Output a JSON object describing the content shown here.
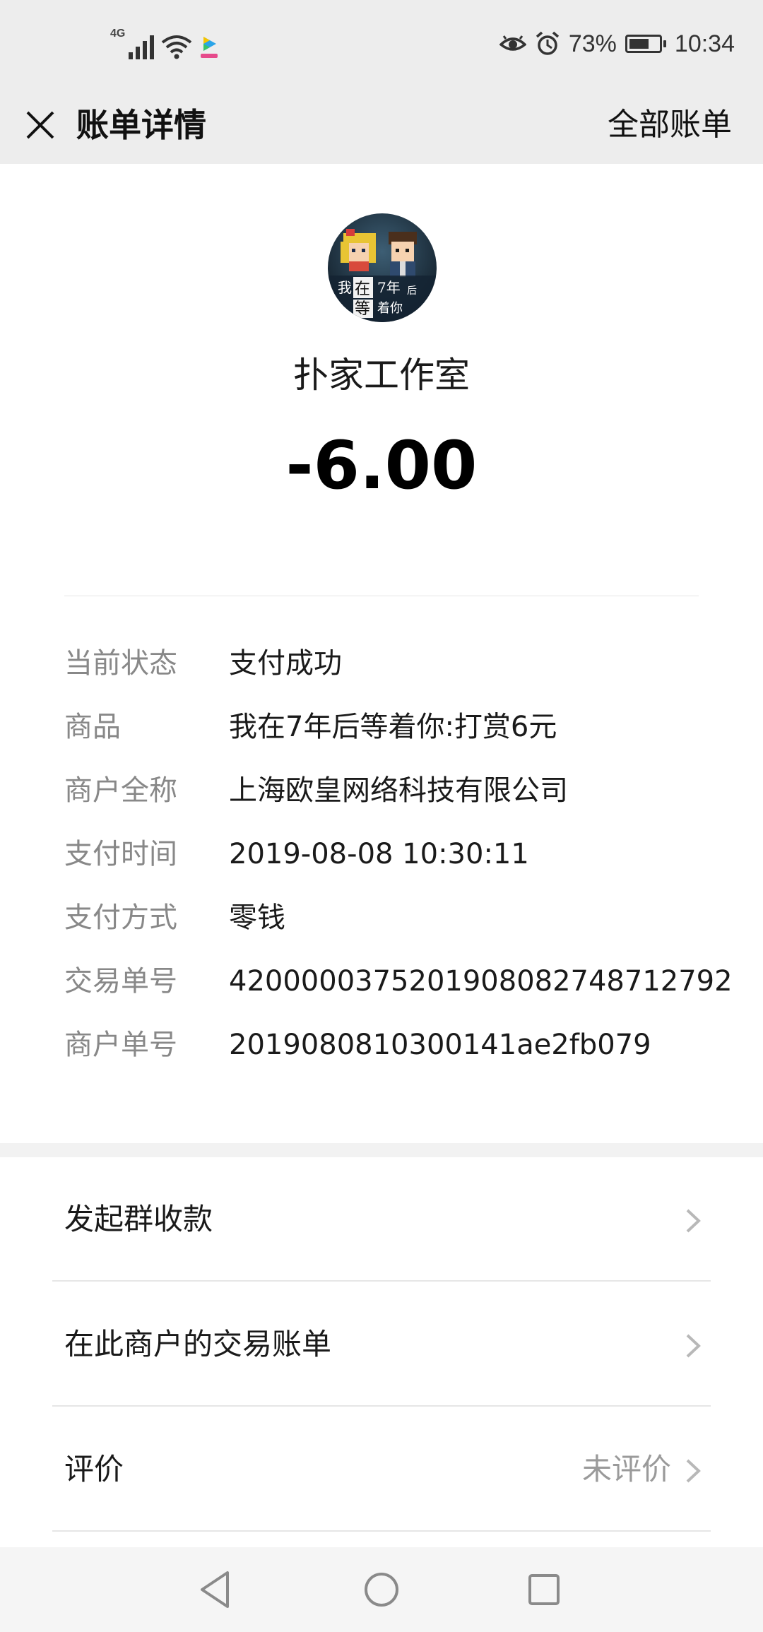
{
  "status_bar": {
    "network": "4G",
    "battery": "73%",
    "battery_level": 0.73,
    "time": "10:34",
    "icons": [
      "signal-4g-icon",
      "wifi-icon",
      "app-notification-icon",
      "eye-comfort-icon",
      "alarm-icon",
      "battery-icon"
    ]
  },
  "title_bar": {
    "title": "账单详情",
    "right_link": "全部账单",
    "close_icon": "close-icon"
  },
  "merchant": {
    "avatar_icon": "merchant-avatar",
    "avatar_text": [
      "我",
      "在",
      "7年",
      "后",
      "等",
      "着你"
    ],
    "name": "扑家工作室",
    "amount": "-6.00"
  },
  "details": [
    {
      "label": "当前状态",
      "value": "支付成功"
    },
    {
      "label": "商品",
      "value": "我在7年后等着你:打赏6元"
    },
    {
      "label": "商户全称",
      "value": "上海欧皇网络科技有限公司"
    },
    {
      "label": "支付时间",
      "value": "2019-08-08 10:30:11"
    },
    {
      "label": "支付方式",
      "value": "零钱"
    },
    {
      "label": "交易单号",
      "value": "4200000375201908082748712792"
    },
    {
      "label": "商户单号",
      "value": "2019080810300141ae2fb079"
    }
  ],
  "actions": [
    {
      "label": "发起群收款",
      "extra": ""
    },
    {
      "label": "在此商户的交易账单",
      "extra": ""
    },
    {
      "label": "评价",
      "extra": "未评价"
    }
  ],
  "nav_bar": {
    "buttons": [
      "back-icon",
      "home-icon",
      "recents-icon"
    ]
  },
  "colors": {
    "header_bg": "#ededed",
    "label_gray": "#888888",
    "text_dark": "#1a1a1a",
    "divider": "#e5e5e5"
  }
}
